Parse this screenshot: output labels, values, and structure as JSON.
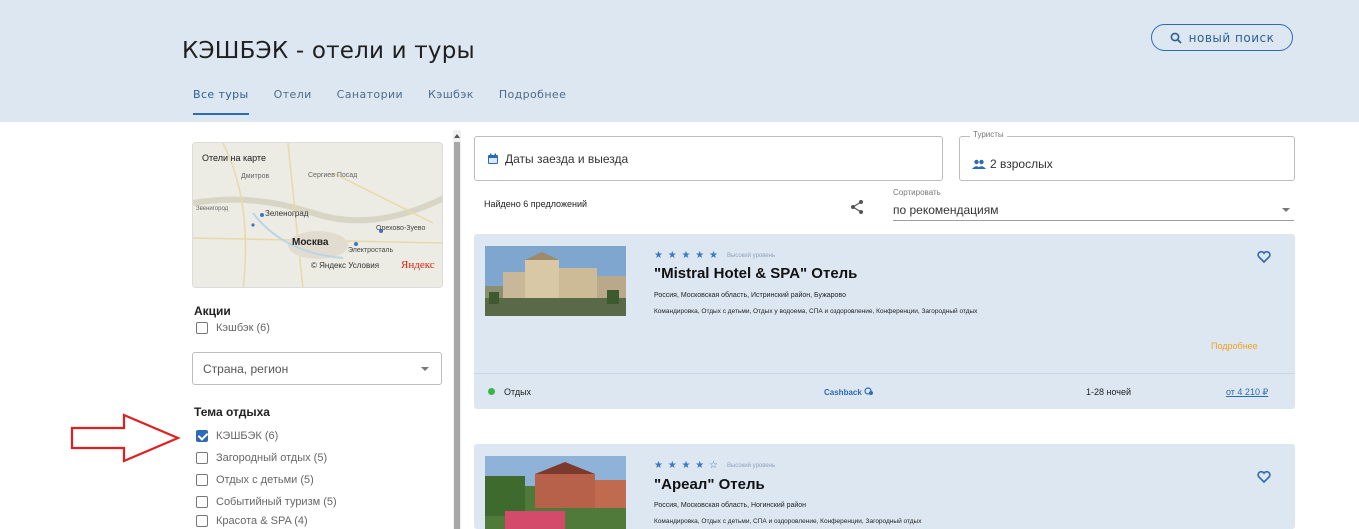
{
  "header": {
    "title": "КЭШБЭК - отели и туры",
    "new_search_label": "новый поиск",
    "tabs": [
      "Все туры",
      "Отели",
      "Санатории",
      "Кэшбэк",
      "Подробнее"
    ],
    "active_tab": 0
  },
  "sidebar": {
    "map": {
      "title": "Отели на карте",
      "labels": {
        "dmitrov": "Дмитров",
        "sergiev": "Сергиев Посад",
        "zelenograd": "Зеленоград",
        "moscow": "Москва",
        "orekhovo": "Орехово-Зуево",
        "elektrostal": "Электросталь",
        "zvenigorod": "Звенигород",
        "copyright": "© Яндекс Условия",
        "yandex_logo": "Яндекс"
      }
    },
    "promo": {
      "title": "Акции",
      "items": [
        {
          "label": "Кэшбэк (6)",
          "checked": false
        }
      ]
    },
    "region_select": {
      "placeholder": "Страна, регион"
    },
    "theme": {
      "title": "Тема отдыха",
      "items": [
        {
          "label": "КЭШБЭК (6)",
          "checked": true
        },
        {
          "label": "Загородный отдых (5)",
          "checked": false
        },
        {
          "label": "Отдых с детьми (5)",
          "checked": false
        },
        {
          "label": "Событийный туризм (5)",
          "checked": false
        },
        {
          "label": "Красота & SPA (4)",
          "checked": false
        }
      ]
    }
  },
  "filters": {
    "dates_label": "Даты заезда и выезда",
    "tourists_legend": "Туристы",
    "tourists_value": "2 взрослых",
    "found_text": "Найдено 6 предложений",
    "sort_label": "Сортировать",
    "sort_value": "по рекомендациям"
  },
  "hotels": [
    {
      "stars": "★ ★ ★ ★ ★",
      "level": "Высокий уровень",
      "name": "\"Mistral Hotel & SPA\" Отель",
      "location": "Россия, Московская область, Истринский район, Бужарово",
      "tags": "Командировка, Отдых с детьми, Отдых у водоема, СПА и оздоровление, Конференции, Загородный отдых",
      "more": "Подробнее",
      "type": "Отдых",
      "cashback": "Cashback",
      "nights": "1-28 ночей",
      "price": "от 4 210 ₽"
    },
    {
      "stars": "★ ★ ★ ★ ☆",
      "level": "Высокий уровень",
      "name": "\"Ареал\" Отель",
      "location": "Россия, Московская область, Ногинский район",
      "tags": "Командировка, Отдых с детьми, СПА и оздоровление, Конференции, Загородный отдых"
    }
  ],
  "colors": {
    "header_bg": "#dde7f1",
    "accent": "#2d6bb5",
    "more_link": "#f0a020",
    "status_dot": "#3bb54a",
    "arrow": "#e02020"
  }
}
